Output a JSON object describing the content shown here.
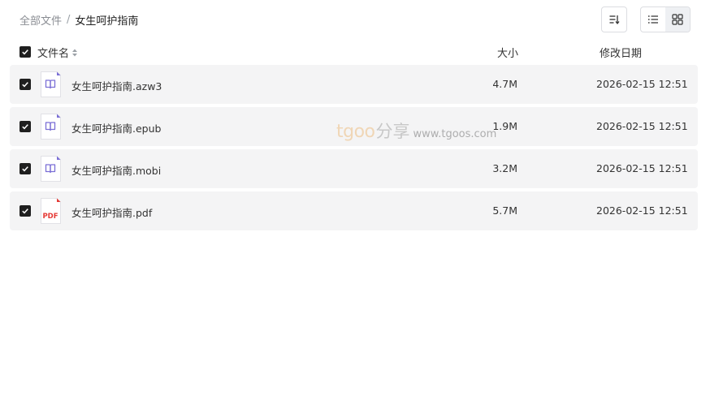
{
  "breadcrumb": {
    "root": "全部文件",
    "separator": "/",
    "current": "女生呵护指南"
  },
  "toolbar": {
    "sort_icon": "sort-icon",
    "view_modes": [
      "list-view-icon",
      "grid-view-icon"
    ],
    "active_view": "list"
  },
  "columns": {
    "name": "文件名",
    "size": "大小",
    "date": "修改日期"
  },
  "files": [
    {
      "name": "女生呵护指南.azw3",
      "size": "4.7M",
      "date": "2026-02-15 12:51",
      "icon": "ebook-icon",
      "checked": true
    },
    {
      "name": "女生呵护指南.epub",
      "size": "1.9M",
      "date": "2026-02-15 12:51",
      "icon": "ebook-icon",
      "checked": true
    },
    {
      "name": "女生呵护指南.mobi",
      "size": "3.2M",
      "date": "2026-02-15 12:51",
      "icon": "ebook-icon",
      "checked": true
    },
    {
      "name": "女生呵护指南.pdf",
      "size": "5.7M",
      "date": "2026-02-15 12:51",
      "icon": "pdf-icon",
      "pdf_label": "PDF",
      "checked": true
    }
  ],
  "watermark": {
    "brand": "tgoo",
    "cn": "分享",
    "url": "www.tgoos.com"
  },
  "colors": {
    "ebook_icon": "#7b6fd6",
    "pdf_icon": "#e53935",
    "checkbox": "#1f1f1f",
    "row_bg": "#f4f4f5"
  }
}
